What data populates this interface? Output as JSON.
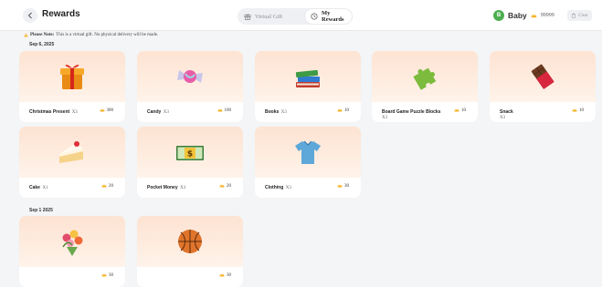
{
  "header": {
    "title": "Rewards",
    "tabs": [
      {
        "label": "Virtual Gift",
        "icon": "gift-outline-icon"
      },
      {
        "label": "My Rewards",
        "icon": "clock-icon"
      }
    ],
    "user": {
      "initial": "B",
      "name": "Baby",
      "points": "99999"
    },
    "clear_label": "Clear"
  },
  "notice": {
    "bold": "Please Note:",
    "text": "This is a virtual gift. No physical delivery will be made."
  },
  "groups": [
    {
      "date": "Sep 6, 2025",
      "items": [
        {
          "name": "Christmas Present",
          "qty": "X3",
          "points": "300",
          "icon": "gift-box-icon"
        },
        {
          "name": "Candy",
          "qty": "X3",
          "points": "100",
          "icon": "candy-icon"
        },
        {
          "name": "Books",
          "qty": "X3",
          "points": "10",
          "icon": "books-icon"
        },
        {
          "name": "Board Game Puzzle Blocks",
          "qty": "X3",
          "points": "10",
          "icon": "puzzle-piece-icon"
        },
        {
          "name": "Snack",
          "qty": "X3",
          "points": "10",
          "icon": "chocolate-bar-icon"
        },
        {
          "name": "Cake",
          "qty": "X1",
          "points": "20",
          "icon": "cake-slice-icon"
        },
        {
          "name": "Pocket Money",
          "qty": "X3",
          "points": "20",
          "icon": "money-icon"
        },
        {
          "name": "Clothing",
          "qty": "X3",
          "points": "30",
          "icon": "shirt-icon"
        }
      ]
    },
    {
      "date": "Sep 1 2025",
      "items": [
        {
          "name": "",
          "qty": "",
          "points": "30",
          "icon": "flower-bouquet-icon"
        },
        {
          "name": "",
          "qty": "",
          "points": "30",
          "icon": "basketball-icon"
        }
      ]
    }
  ],
  "colors": {
    "accent_green": "#4caf50",
    "coin": "#f5b324",
    "card_bg": "#fde3d2"
  }
}
